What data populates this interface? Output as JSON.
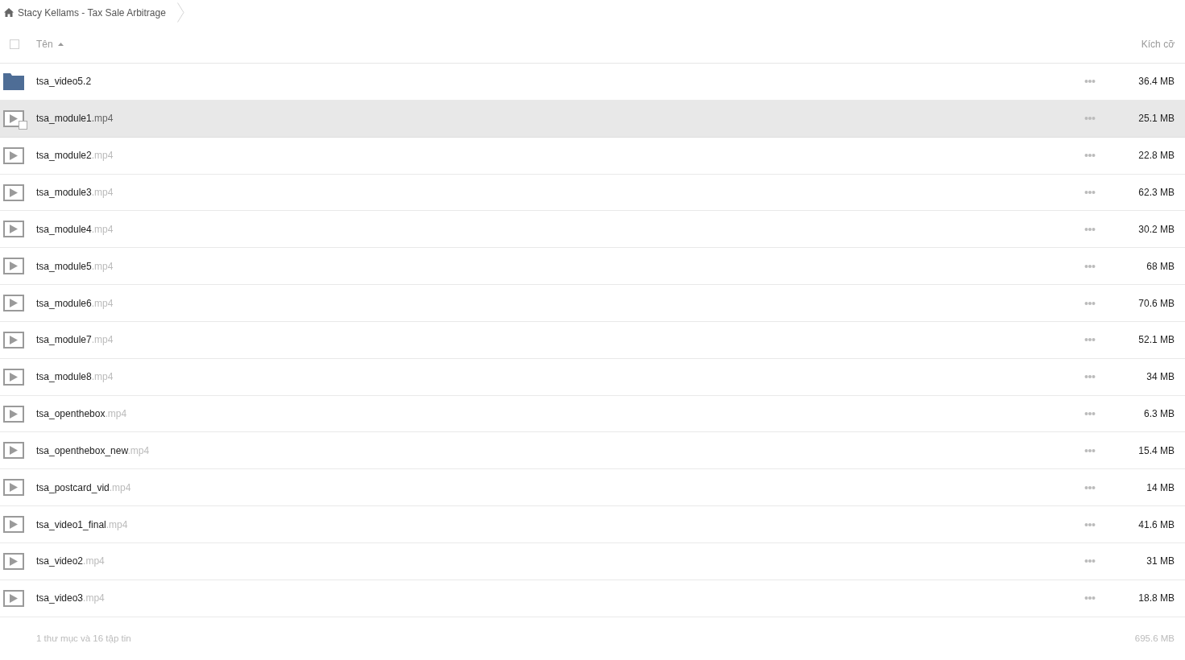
{
  "breadcrumb": {
    "label": "Stacy Kellams - Tax Sale Arbitrage"
  },
  "header": {
    "name_column": "Tên",
    "sort_ascending": true,
    "size_column": "Kích cỡ",
    "checked": false
  },
  "rows": [
    {
      "kind": "folder",
      "name": "tsa_video5.2",
      "size": "36.4 MB",
      "hovered": false
    },
    {
      "kind": "video",
      "name": "tsa_module1",
      "extension": ".mp4",
      "size": "25.1 MB",
      "hovered": true
    },
    {
      "kind": "video",
      "name": "tsa_module2",
      "extension": ".mp4",
      "size": "22.8 MB",
      "hovered": false
    },
    {
      "kind": "video",
      "name": "tsa_module3",
      "extension": ".mp4",
      "size": "62.3 MB",
      "hovered": false
    },
    {
      "kind": "video",
      "name": "tsa_module4",
      "extension": ".mp4",
      "size": "30.2 MB",
      "hovered": false
    },
    {
      "kind": "video",
      "name": "tsa_module5",
      "extension": ".mp4",
      "size": "68 MB",
      "hovered": false
    },
    {
      "kind": "video",
      "name": "tsa_module6",
      "extension": ".mp4",
      "size": "70.6 MB",
      "hovered": false
    },
    {
      "kind": "video",
      "name": "tsa_module7",
      "extension": ".mp4",
      "size": "52.1 MB",
      "hovered": false
    },
    {
      "kind": "video",
      "name": "tsa_module8",
      "extension": ".mp4",
      "size": "34 MB",
      "hovered": false
    },
    {
      "kind": "video",
      "name": "tsa_openthebox",
      "extension": ".mp4",
      "size": "6.3 MB",
      "hovered": false
    },
    {
      "kind": "video",
      "name": "tsa_openthebox_new",
      "extension": ".mp4",
      "size": "15.4 MB",
      "hovered": false
    },
    {
      "kind": "video",
      "name": "tsa_postcard_vid",
      "extension": ".mp4",
      "size": "14 MB",
      "hovered": false
    },
    {
      "kind": "video",
      "name": "tsa_video1_final",
      "extension": ".mp4",
      "size": "41.6 MB",
      "hovered": false
    },
    {
      "kind": "video",
      "name": "tsa_video2",
      "extension": ".mp4",
      "size": "31 MB",
      "hovered": false
    },
    {
      "kind": "video",
      "name": "tsa_video3",
      "extension": ".mp4",
      "size": "18.8 MB",
      "hovered": false
    }
  ],
  "footer": {
    "summary": "1 thư mục và 16 tập tin",
    "total_size": "695.6 MB"
  }
}
